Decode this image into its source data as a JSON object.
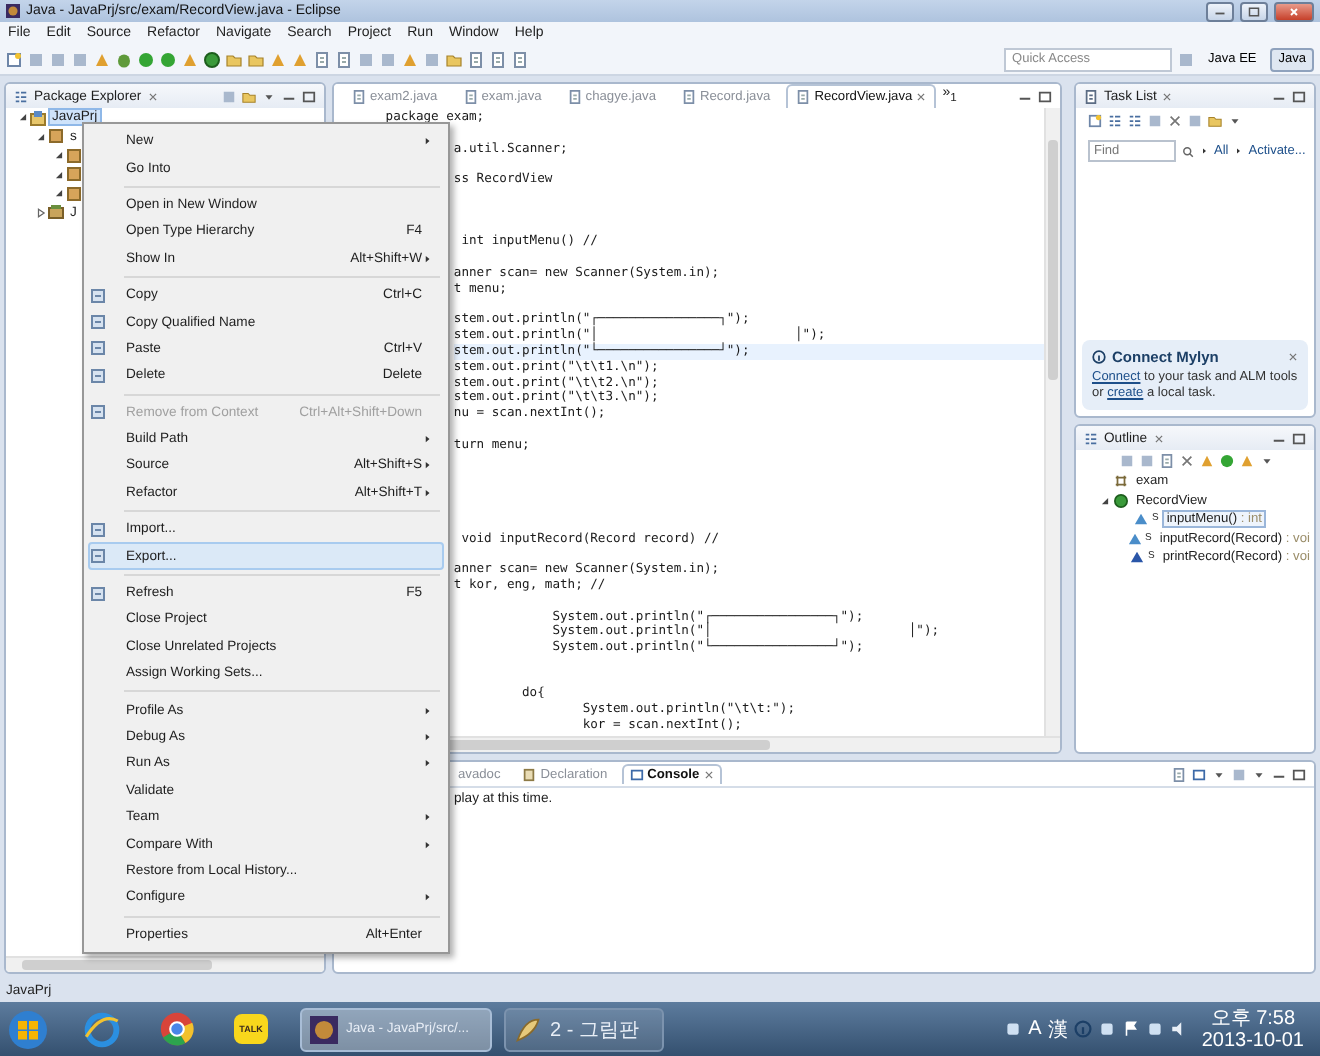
{
  "window": {
    "title": "Java - JavaPrj/src/exam/RecordView.java - Eclipse"
  },
  "menu_bar": [
    "File",
    "Edit",
    "Source",
    "Refactor",
    "Navigate",
    "Search",
    "Project",
    "Run",
    "Window",
    "Help"
  ],
  "toolbar": {
    "quick_access": {
      "placeholder": "Quick Access"
    },
    "perspectives": [
      {
        "label": "Java EE",
        "selected": false
      },
      {
        "label": "Java",
        "selected": true
      }
    ]
  },
  "package_explorer": {
    "title": "Package Explorer",
    "tree": [
      {
        "label": "JavaPrj",
        "selected": true,
        "expanded": true,
        "children": [
          {
            "label": "s",
            "selected": false,
            "expanded": true,
            "children": [
              {
                "selected": false,
                "expanded": true
              },
              {
                "selected": false,
                "expanded": true
              },
              {
                "selected": false,
                "expanded": true
              }
            ]
          },
          {
            "label": "J",
            "selected": false,
            "expanded": false
          }
        ]
      }
    ]
  },
  "editor": {
    "tabs": [
      {
        "label": "exam2.java",
        "selected": false
      },
      {
        "label": "exam.java",
        "selected": false
      },
      {
        "label": "chagye.java",
        "selected": false
      },
      {
        "label": "Record.java",
        "selected": false
      },
      {
        "label": "RecordView.java",
        "selected": true
      }
    ],
    "overflow": "»$_{1}$",
    "lines": [
      {
        "kind": "code",
        "text": " package exam;",
        "current": false
      },
      {
        "kind": "blank"
      },
      {
        "kind": "code",
        "text": "          a.util.Scanner;",
        "current": false
      },
      {
        "kind": "blank"
      },
      {
        "kind": "code",
        "text": "          ss RecordView",
        "current": false
      },
      {
        "kind": "blank"
      },
      {
        "kind": "blank"
      },
      {
        "kind": "blank"
      },
      {
        "kind": "code",
        "text": "           int inputMenu() //",
        "current": false
      },
      {
        "kind": "blank"
      },
      {
        "kind": "code",
        "text": "          anner scan= new Scanner(System.in);",
        "current": false
      },
      {
        "kind": "code",
        "text": "          t menu;",
        "current": false
      },
      {
        "kind": "blank"
      },
      {
        "kind": "code",
        "text": "          stem.out.println(\"┌────────────────┐\");",
        "current": false
      },
      {
        "kind": "code",
        "text": "          stem.out.println(\"│                          │\");",
        "current": false
      },
      {
        "kind": "code",
        "text": "          stem.out.println(\"└────────────────┘\");",
        "current": true
      },
      {
        "kind": "code",
        "text": "          stem.out.print(\"\\t\\t1.\\n\");",
        "current": false
      },
      {
        "kind": "code",
        "text": "          stem.out.print(\"\\t\\t2.\\n\");",
        "current": false
      },
      {
        "kind": "code",
        "text": "          stem.out.print(\"\\t\\t3.\\n\");",
        "current": false
      },
      {
        "kind": "code",
        "text": "          nu = scan.nextInt();",
        "current": false
      },
      {
        "kind": "blank"
      },
      {
        "kind": "code",
        "text": "          turn menu;",
        "current": false
      },
      {
        "kind": "blank"
      },
      {
        "kind": "blank"
      },
      {
        "kind": "blank"
      },
      {
        "kind": "blank"
      },
      {
        "kind": "blank"
      },
      {
        "kind": "code",
        "text": "           void inputRecord(Record record) //",
        "current": false
      },
      {
        "kind": "blank"
      },
      {
        "kind": "code",
        "text": "          anner scan= new Scanner(System.in);",
        "current": false
      },
      {
        "kind": "code",
        "text": "          t kor, eng, math; //",
        "current": false
      },
      {
        "kind": "blank"
      },
      {
        "kind": "code",
        "text": "                       System.out.println(\"┌────────────────┐\");",
        "current": false
      },
      {
        "kind": "code",
        "text": "                       System.out.println(\"│                          │\");",
        "current": false
      },
      {
        "kind": "code",
        "text": "                       System.out.println(\"└────────────────┘\");",
        "current": false
      },
      {
        "kind": "blank"
      },
      {
        "kind": "blank"
      },
      {
        "kind": "code",
        "text": "                   do{",
        "current": false
      },
      {
        "kind": "code",
        "text": "                           System.out.println(\"\\t\\t:\");",
        "current": false
      },
      {
        "kind": "code",
        "text": "                           kor = scan.nextInt();",
        "current": false
      }
    ]
  },
  "task_list": {
    "title": "Task List",
    "find": {
      "placeholder": "Find"
    },
    "filters": [
      "All",
      "Activate..."
    ],
    "mylyn": {
      "title": "Connect Mylyn",
      "message": [
        {
          "text": "Connect",
          "link": true
        },
        {
          "text": " to your task and ALM tools or ",
          "link": false
        },
        {
          "text": "create",
          "link": true
        },
        {
          "text": " a local task.",
          "link": false
        }
      ]
    }
  },
  "outline": {
    "title": "Outline",
    "items": [
      {
        "label": "exam",
        "kind": "package",
        "selected": false
      },
      {
        "label": "RecordView",
        "kind": "class",
        "selected": false,
        "expanded": true,
        "children": [
          {
            "label": "inputMenu()",
            "type": " : int",
            "modifier": "S",
            "kind": "method",
            "color": "#4a8dc9",
            "selected": true
          },
          {
            "label": "inputRecord(Record)",
            "type": " : voi",
            "modifier": "S",
            "kind": "method",
            "color": "#4a8dc9",
            "selected": false
          },
          {
            "label": "printRecord(Record)",
            "type": " : voi",
            "modifier": "S",
            "kind": "method",
            "color": "#2a56a8",
            "selected": false
          }
        ]
      }
    ]
  },
  "console": {
    "tabs": [
      {
        "label": "avadoc",
        "selected": false
      },
      {
        "label": "Declaration",
        "selected": false
      },
      {
        "label": "Console",
        "selected": true
      }
    ],
    "message": "play at this time."
  },
  "context_menu": [
    {
      "kind": "item",
      "label": "New",
      "submenu": true,
      "selected": false,
      "disabled": false
    },
    {
      "kind": "item",
      "label": "Go Into",
      "selected": false,
      "disabled": false
    },
    {
      "kind": "separator"
    },
    {
      "kind": "item",
      "label": "Open in New Window",
      "selected": false,
      "disabled": false
    },
    {
      "kind": "item",
      "label": "Open Type Hierarchy",
      "shortcut": "F4",
      "selected": false,
      "disabled": false
    },
    {
      "kind": "item",
      "label": "Show In",
      "shortcut": "Alt+Shift+W",
      "submenu": true,
      "selected": false,
      "disabled": false
    },
    {
      "kind": "separator"
    },
    {
      "kind": "item",
      "label": "Copy",
      "shortcut": "Ctrl+C",
      "has_icon": true,
      "selected": false,
      "disabled": false
    },
    {
      "kind": "item",
      "label": "Copy Qualified Name",
      "has_icon": true,
      "selected": false,
      "disabled": false
    },
    {
      "kind": "item",
      "label": "Paste",
      "shortcut": "Ctrl+V",
      "has_icon": true,
      "selected": false,
      "disabled": false
    },
    {
      "kind": "item",
      "label": "Delete",
      "shortcut": "Delete",
      "has_icon": true,
      "selected": false,
      "disabled": false
    },
    {
      "kind": "separator"
    },
    {
      "kind": "item",
      "label": "Remove from Context",
      "shortcut": "Ctrl+Alt+Shift+Down",
      "has_icon": true,
      "selected": false,
      "disabled": true
    },
    {
      "kind": "item",
      "label": "Build Path",
      "submenu": true,
      "selected": false,
      "disabled": false
    },
    {
      "kind": "item",
      "label": "Source",
      "shortcut": "Alt+Shift+S",
      "submenu": true,
      "selected": false,
      "disabled": false
    },
    {
      "kind": "item",
      "label": "Refactor",
      "shortcut": "Alt+Shift+T",
      "submenu": true,
      "selected": false,
      "disabled": false
    },
    {
      "kind": "separator"
    },
    {
      "kind": "item",
      "label": "Import...",
      "has_icon": true,
      "selected": false,
      "disabled": false
    },
    {
      "kind": "item",
      "label": "Export...",
      "has_icon": true,
      "selected": true,
      "disabled": false
    },
    {
      "kind": "separator"
    },
    {
      "kind": "item",
      "label": "Refresh",
      "shortcut": "F5",
      "has_icon": true,
      "selected": false,
      "disabled": false
    },
    {
      "kind": "item",
      "label": "Close Project",
      "selected": false,
      "disabled": false
    },
    {
      "kind": "item",
      "label": "Close Unrelated Projects",
      "selected": false,
      "disabled": false
    },
    {
      "kind": "item",
      "label": "Assign Working Sets...",
      "selected": false,
      "disabled": false
    },
    {
      "kind": "separator"
    },
    {
      "kind": "item",
      "label": "Profile As",
      "submenu": true,
      "selected": false,
      "disabled": false
    },
    {
      "kind": "item",
      "label": "Debug As",
      "submenu": true,
      "selected": false,
      "disabled": false
    },
    {
      "kind": "item",
      "label": "Run As",
      "submenu": true,
      "selected": false,
      "disabled": false
    },
    {
      "kind": "item",
      "label": "Validate",
      "selected": false,
      "disabled": false
    },
    {
      "kind": "item",
      "label": "Team",
      "submenu": true,
      "selected": false,
      "disabled": false
    },
    {
      "kind": "item",
      "label": "Compare With",
      "submenu": true,
      "selected": false,
      "disabled": false
    },
    {
      "kind": "item",
      "label": "Restore from Local History...",
      "selected": false,
      "disabled": false
    },
    {
      "kind": "item",
      "label": "Configure",
      "submenu": true,
      "selected": false,
      "disabled": false
    },
    {
      "kind": "separator"
    },
    {
      "kind": "item",
      "label": "Properties",
      "shortcut": "Alt+Enter",
      "selected": false,
      "disabled": false
    }
  ],
  "status_bar": {
    "text": "JavaPrj"
  },
  "taskbar": {
    "pinned_badge": "TALK",
    "tasks": [
      {
        "label": "Java - JavaPrj/src/...",
        "selected": true
      },
      {
        "label": "2 - 그림판",
        "selected": false
      }
    ],
    "ime": [
      "A",
      "漢"
    ],
    "clock": {
      "time": "오후 7:58",
      "date": "2013-10-01"
    }
  }
}
